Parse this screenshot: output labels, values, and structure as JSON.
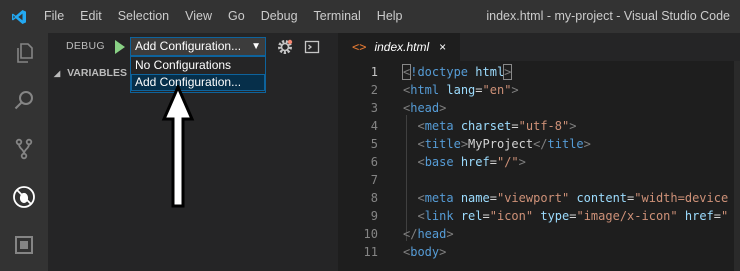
{
  "menu": [
    "File",
    "Edit",
    "Selection",
    "View",
    "Go",
    "Debug",
    "Terminal",
    "Help"
  ],
  "window_title": "index.html - my-project - Visual Studio Code",
  "activity_icons": [
    "explorer-icon",
    "search-icon",
    "source-control-icon",
    "debug-icon",
    "extensions-icon"
  ],
  "debug": {
    "label": "DEBUG",
    "config_selected": "Add Configuration...",
    "dropdown_arrow": "▼",
    "options": [
      "No Configurations",
      "Add Configuration..."
    ]
  },
  "variables": {
    "arrow": "◢",
    "title": "VARIABLES"
  },
  "tab": {
    "icon": "<>",
    "name": "index.html",
    "close": "×"
  },
  "code_lines": [
    {
      "n": "1",
      "tokens": [
        [
          "punc",
          "<"
        ],
        [
          "tag",
          "!doctype"
        ],
        [
          "text",
          " "
        ],
        [
          "attr",
          "html"
        ],
        [
          "punc",
          ">"
        ]
      ]
    },
    {
      "n": "2",
      "tokens": [
        [
          "punc",
          "<"
        ],
        [
          "tag",
          "html"
        ],
        [
          "text",
          " "
        ],
        [
          "attr",
          "lang"
        ],
        [
          "text",
          "="
        ],
        [
          "str",
          "\"en\""
        ],
        [
          "punc",
          ">"
        ]
      ]
    },
    {
      "n": "3",
      "tokens": [
        [
          "punc",
          "<"
        ],
        [
          "tag",
          "head"
        ],
        [
          "punc",
          ">"
        ]
      ]
    },
    {
      "n": "4",
      "tokens": [
        [
          "text",
          "  "
        ],
        [
          "punc",
          "<"
        ],
        [
          "tag",
          "meta"
        ],
        [
          "text",
          " "
        ],
        [
          "attr",
          "charset"
        ],
        [
          "text",
          "="
        ],
        [
          "str",
          "\"utf-8\""
        ],
        [
          "punc",
          ">"
        ]
      ]
    },
    {
      "n": "5",
      "tokens": [
        [
          "text",
          "  "
        ],
        [
          "punc",
          "<"
        ],
        [
          "tag",
          "title"
        ],
        [
          "punc",
          ">"
        ],
        [
          "text",
          "MyProject"
        ],
        [
          "punc",
          "</"
        ],
        [
          "tag",
          "title"
        ],
        [
          "punc",
          ">"
        ]
      ]
    },
    {
      "n": "6",
      "tokens": [
        [
          "text",
          "  "
        ],
        [
          "punc",
          "<"
        ],
        [
          "tag",
          "base"
        ],
        [
          "text",
          " "
        ],
        [
          "attr",
          "href"
        ],
        [
          "text",
          "="
        ],
        [
          "str",
          "\"/\""
        ],
        [
          "punc",
          ">"
        ]
      ]
    },
    {
      "n": "7",
      "tokens": []
    },
    {
      "n": "8",
      "tokens": [
        [
          "text",
          "  "
        ],
        [
          "punc",
          "<"
        ],
        [
          "tag",
          "meta"
        ],
        [
          "text",
          " "
        ],
        [
          "attr",
          "name"
        ],
        [
          "text",
          "="
        ],
        [
          "str",
          "\"viewport\""
        ],
        [
          "text",
          " "
        ],
        [
          "attr",
          "content"
        ],
        [
          "text",
          "="
        ],
        [
          "str",
          "\"width=device"
        ]
      ]
    },
    {
      "n": "9",
      "tokens": [
        [
          "text",
          "  "
        ],
        [
          "punc",
          "<"
        ],
        [
          "tag",
          "link"
        ],
        [
          "text",
          " "
        ],
        [
          "attr",
          "rel"
        ],
        [
          "text",
          "="
        ],
        [
          "str",
          "\"icon\""
        ],
        [
          "text",
          " "
        ],
        [
          "attr",
          "type"
        ],
        [
          "text",
          "="
        ],
        [
          "str",
          "\"image/x-icon\""
        ],
        [
          "text",
          " "
        ],
        [
          "attr",
          "href"
        ],
        [
          "text",
          "="
        ],
        [
          "str",
          "\""
        ]
      ]
    },
    {
      "n": "10",
      "tokens": [
        [
          "punc",
          "</"
        ],
        [
          "tag",
          "head"
        ],
        [
          "punc",
          ">"
        ]
      ]
    },
    {
      "n": "11",
      "tokens": [
        [
          "punc",
          "<"
        ],
        [
          "tag",
          "body"
        ],
        [
          "punc",
          ">"
        ]
      ]
    }
  ]
}
